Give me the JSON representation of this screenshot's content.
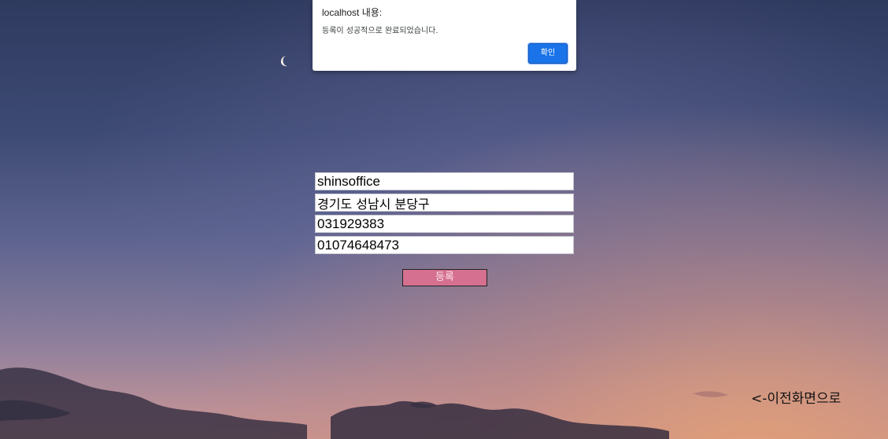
{
  "dialog": {
    "title": "localhost 내용:",
    "message": "등록이 성공적으로 완료되었습니다.",
    "ok_label": "확인"
  },
  "form": {
    "name_value": "shinsoffice",
    "address_value": "경기도 성남시 분당구",
    "phone_value": "031929383",
    "mobile_value": "01074648473",
    "submit_label": "등록"
  },
  "nav": {
    "back_label": "<-이전화면으로"
  },
  "colors": {
    "accent_button": "#d57090",
    "dialog_button": "#1a73e8"
  }
}
